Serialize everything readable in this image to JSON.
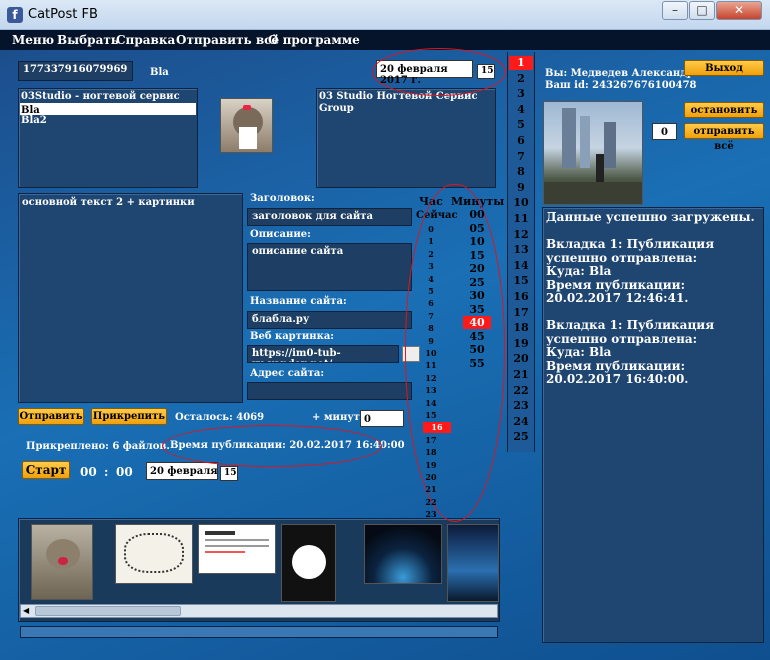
{
  "window": {
    "title": "CatPost FB",
    "icon": "facebook-icon",
    "minimize": "–",
    "maximize": "□",
    "close": "✕"
  },
  "menu": [
    "Меню",
    "Выбрать",
    "Справка",
    "Отправить всё",
    "О программе"
  ],
  "top": {
    "account_id": "177337916079969",
    "group_name": "Bla",
    "date": "20 февраля 2017 г.",
    "calendar_day": "15"
  },
  "groups_list": [
    "03Studio - ногтевой сервис",
    "Bla",
    "Bla2"
  ],
  "groups_selected_index": 1,
  "selected_group": {
    "title": "03 Studio Ногтевой Сервис",
    "type": "Group"
  },
  "main_text": "основной текст 2 + картинки",
  "link": {
    "header_label": "Заголовок:",
    "header_value": "заголовок для сайта",
    "description_label": "Описание:",
    "description_value": "описание сайта",
    "site_name_label": "Название сайта:",
    "site_name_value": "блабла.ру",
    "web_image_label": "Веб картинка:",
    "web_image_value": "https://im0-tub-ru.yandex.net/",
    "address_label": "Адрес сайта:",
    "address_value": ""
  },
  "buttons": {
    "send": "Отправить",
    "attach": "Прикрепить",
    "start": "Старт",
    "exit": "Выход",
    "stop": "остановить",
    "send_all": "отправить всё"
  },
  "remaining": "Осталось: 4069",
  "plus_minutes_label": "+ минут",
  "plus_minutes_value": "0",
  "attached": "Прикреплено: 6 файлов.",
  "publish_time": "Время публикации: 20.02.2017 16:40:00",
  "timer": {
    "hours": "00",
    "sep": ":",
    "minutes": "00"
  },
  "bottom_date": "20 февраля 201",
  "bottom_calendar_day": "15",
  "hours": {
    "label": "Час",
    "now_label": "Сейчас",
    "items": [
      "0",
      "1",
      "2",
      "3",
      "4",
      "5",
      "6",
      "7",
      "8",
      "9",
      "10",
      "11",
      "12",
      "13",
      "14",
      "15",
      "16",
      "17",
      "18",
      "19",
      "20",
      "21",
      "22",
      "23"
    ],
    "selected": "16"
  },
  "minutes": {
    "label": "Минуты",
    "items": [
      "00",
      "05",
      "10",
      "15",
      "20",
      "25",
      "30",
      "35",
      "40",
      "45",
      "50",
      "55"
    ],
    "selected": "40"
  },
  "days": {
    "items": [
      "1",
      "2",
      "3",
      "4",
      "5",
      "6",
      "7",
      "8",
      "9",
      "10",
      "11",
      "12",
      "13",
      "14",
      "15",
      "16",
      "17",
      "18",
      "19",
      "20",
      "21",
      "22",
      "23",
      "24",
      "25"
    ],
    "selected": "1"
  },
  "user": {
    "name_line": "Вы: Медведев Александр",
    "id_line": "Ваш id: 243267676100478",
    "counter": "0"
  },
  "log": [
    "Данные успешно загружены.",
    "",
    "Вкладка 1: Публикация успешно отправлена:",
    "Куда: Bla",
    "Время публикации: 20.02.2017 12:46:41.",
    "",
    "Вкладка 1: Публикация успешно отправлена:",
    "Куда: Bla",
    "Время публикации: 20.02.2017 16:40:00."
  ],
  "colors": {
    "accent_red": "#ff1a1a",
    "button_orange": "#f0a00c",
    "menubar": "#05142b",
    "panel": "#1f4671",
    "annotation": "#e0141e"
  }
}
